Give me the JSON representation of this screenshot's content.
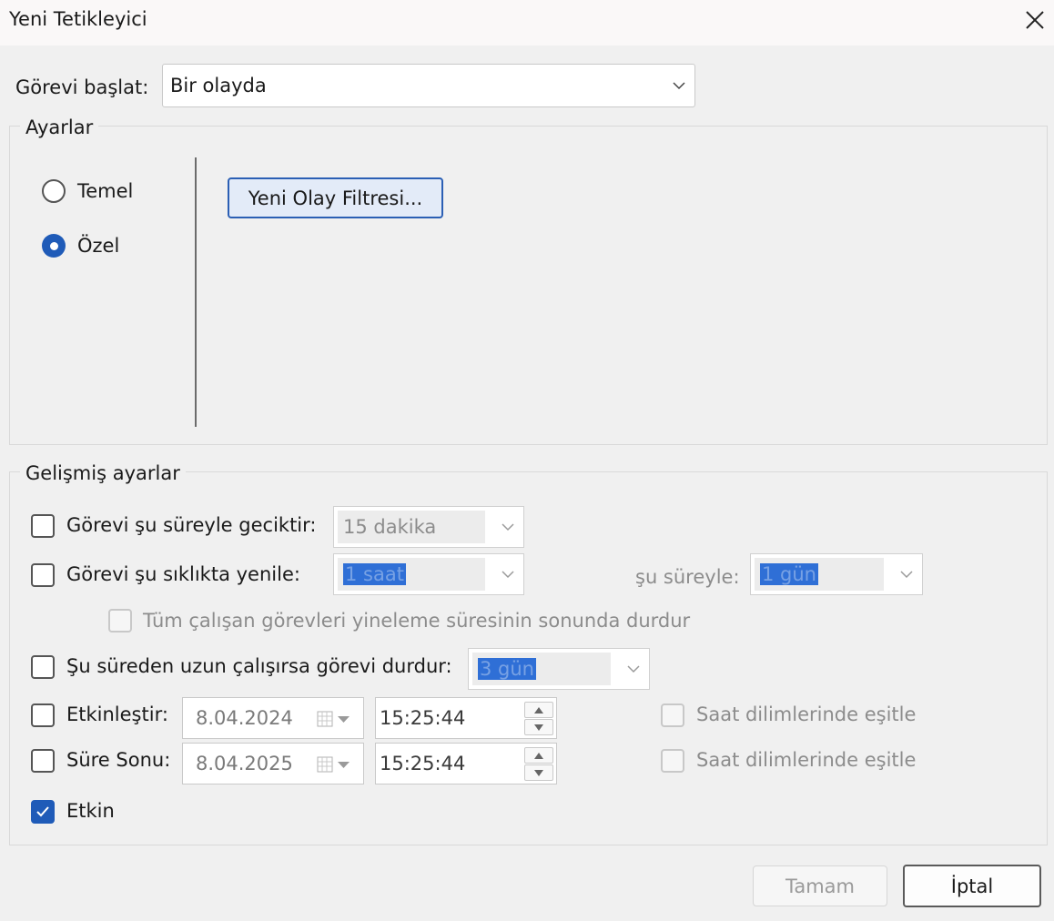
{
  "window": {
    "title": "Yeni Tetikleyici"
  },
  "start": {
    "label": "Görevi başlat:",
    "value": "Bir olayda"
  },
  "settings": {
    "legend": "Ayarlar",
    "radio_basic": "Temel",
    "radio_custom": "Özel",
    "new_filter_button": "Yeni Olay Filtresi..."
  },
  "advanced": {
    "legend": "Gelişmiş ayarlar",
    "delay": {
      "label": "Görevi şu süreyle geciktir:",
      "value": "15 dakika"
    },
    "repeat": {
      "label": "Görevi şu sıklıkta yenile:",
      "value": "1 saat",
      "duration_label": "şu süreyle:",
      "duration_value": "1 gün"
    },
    "stop_all": {
      "label": "Tüm çalışan görevleri yineleme süresinin sonunda durdur"
    },
    "stop_if_longer": {
      "label": "Şu süreden uzun çalışırsa görevi durdur:",
      "value": "3 gün"
    },
    "activate": {
      "label": "Etkinleştir:",
      "date": "8.04.2024",
      "time": "15:25:44",
      "sync_label": "Saat dilimlerinde eşitle"
    },
    "expire": {
      "label": "Süre Sonu:",
      "date": "8.04.2025",
      "time": "15:25:44",
      "sync_label": "Saat dilimlerinde eşitle"
    },
    "enabled": {
      "label": "Etkin",
      "checked": true
    }
  },
  "buttons": {
    "ok": "Tamam",
    "cancel": "İptal"
  }
}
